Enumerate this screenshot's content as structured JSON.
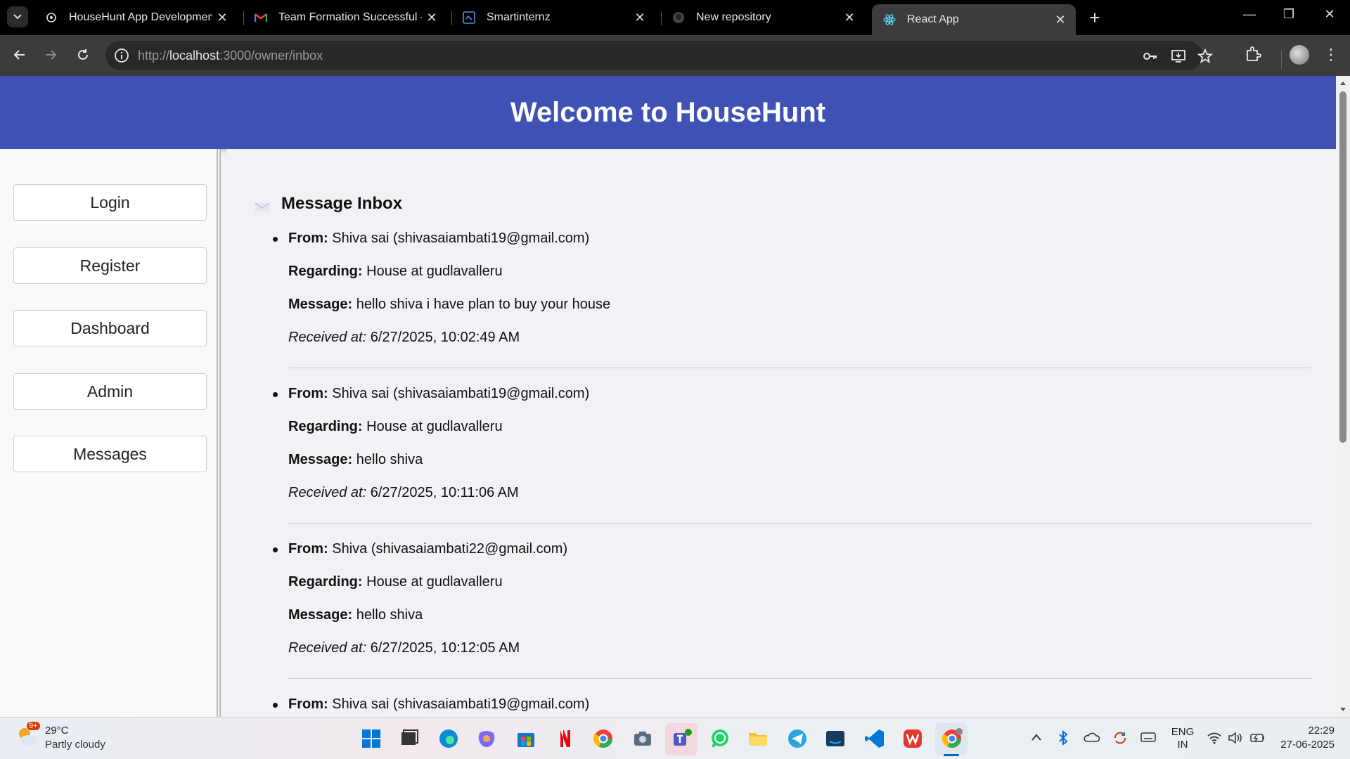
{
  "browser": {
    "tabs": [
      {
        "title": "HouseHunt App Development",
        "icon": "chatgpt-icon",
        "active": false
      },
      {
        "title": "Team Formation Successful - Sr",
        "icon": "gmail-icon",
        "active": false
      },
      {
        "title": "Smartinternz",
        "icon": "smartinternz-icon",
        "active": false
      },
      {
        "title": "New repository",
        "icon": "github-icon",
        "active": false
      },
      {
        "title": "React App",
        "icon": "react-icon",
        "active": true
      }
    ],
    "url_prefix": "http://",
    "url_host": "localhost",
    "url_rest": ":3000/owner/inbox"
  },
  "page": {
    "header_title": "Welcome to HouseHunt",
    "sidebar": [
      "Login",
      "Register",
      "Dashboard",
      "Admin",
      "Messages"
    ],
    "inbox_title": "Message Inbox",
    "labels": {
      "from": "From:",
      "regarding": "Regarding:",
      "message": "Message:",
      "received": "Received at:"
    },
    "messages": [
      {
        "from": "Shiva sai (shivasaiambati19@gmail.com)",
        "regarding": "House at gudlavalleru",
        "message": "hello shiva i have plan to buy your house",
        "received": "6/27/2025, 10:02:49 AM"
      },
      {
        "from": "Shiva sai (shivasaiambati19@gmail.com)",
        "regarding": "House at gudlavalleru",
        "message": "hello shiva",
        "received": "6/27/2025, 10:11:06 AM"
      },
      {
        "from": "Shiva (shivasaiambati22@gmail.com)",
        "regarding": "House at gudlavalleru",
        "message": "hello shiva",
        "received": "6/27/2025, 10:12:05 AM"
      },
      {
        "from": "Shiva sai (shivasaiambati19@gmail.com)"
      }
    ]
  },
  "taskbar": {
    "weather_temp": "29°C",
    "weather_cond": "Partly cloudy",
    "weather_badge": "9+",
    "lang_top": "ENG",
    "lang_bottom": "IN",
    "time": "22:29",
    "date": "27-06-2025"
  },
  "colors": {
    "header": "#3f51b5",
    "page_bg": "#f0f2f5",
    "chrome_dark": "#3c3c3c"
  }
}
